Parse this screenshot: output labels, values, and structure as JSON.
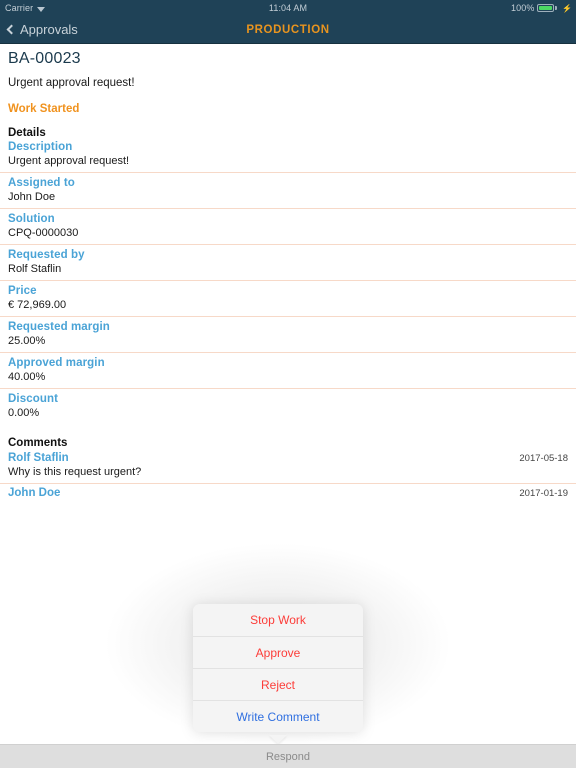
{
  "status_bar": {
    "carrier": "Carrier",
    "wifi_icon": "wifi-icon",
    "time": "11:04 AM",
    "battery_percent": "100%",
    "battery_icon": "battery-full-icon",
    "charging_icon": "lightning-bolt-icon"
  },
  "nav": {
    "back_label": "Approvals",
    "back_icon": "chevron-left-icon",
    "title": "PRODUCTION",
    "title_color": "#e8941f",
    "bar_color": "#1f4257"
  },
  "record": {
    "id": "BA-00023",
    "subtitle": "Urgent approval request!",
    "status": "Work Started",
    "status_color": "#f0921e",
    "details_heading": "Details"
  },
  "fields": [
    {
      "label": "Description",
      "value": "Urgent approval request!"
    },
    {
      "label": "Assigned to",
      "value": "John Doe"
    },
    {
      "label": "Solution",
      "value": "CPQ-0000030"
    },
    {
      "label": "Requested by",
      "value": "Rolf Staflin"
    },
    {
      "label": "Price",
      "value": "€ 72,969.00"
    },
    {
      "label": "Requested margin",
      "value": "25.00%"
    },
    {
      "label": "Approved margin",
      "value": "40.00%"
    },
    {
      "label": "Discount",
      "value": "0.00%"
    }
  ],
  "comments": {
    "heading": "Comments",
    "items": [
      {
        "author": "Rolf Staflin",
        "date": "2017-05-18",
        "body": "Why is this request urgent?"
      },
      {
        "author": "John Doe",
        "date": "2017-01-19",
        "body": ""
      }
    ]
  },
  "action_sheet": {
    "items": [
      {
        "label": "Stop Work",
        "style": "destructive"
      },
      {
        "label": "Approve",
        "style": "destructive"
      },
      {
        "label": "Reject",
        "style": "destructive"
      },
      {
        "label": "Write Comment",
        "style": "normal"
      }
    ],
    "destructive_color": "#fc3d39",
    "normal_color": "#2f6fe0"
  },
  "toolbar": {
    "respond_label": "Respond"
  }
}
